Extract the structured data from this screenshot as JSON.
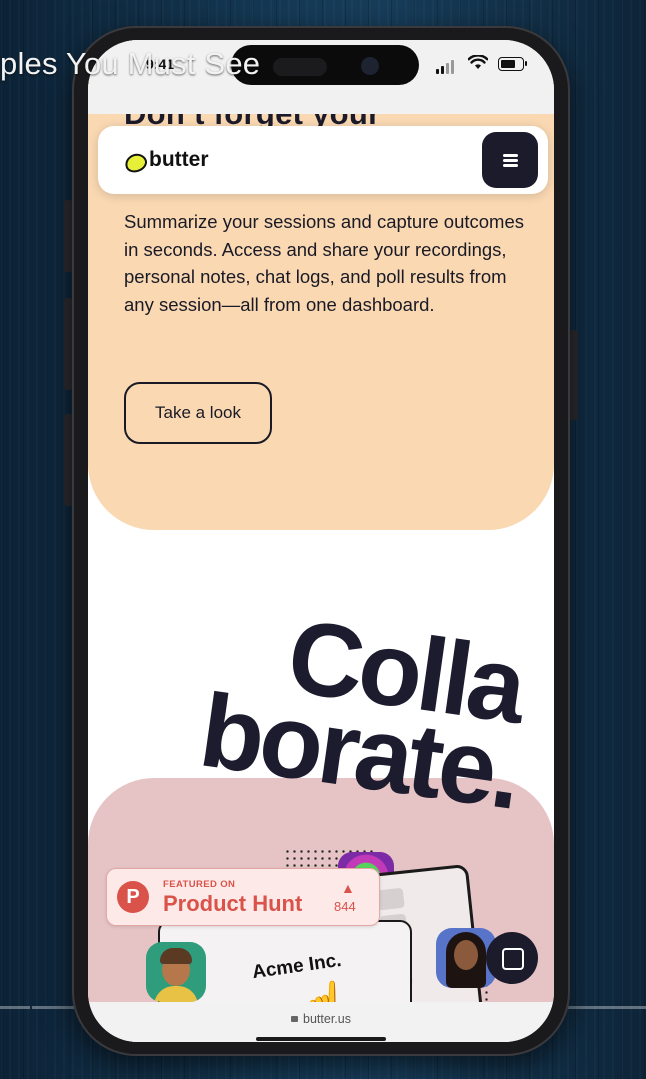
{
  "video": {
    "title": "ples You Must See"
  },
  "status_bar": {
    "time": "9:41"
  },
  "hero": {
    "heading_partial": "Don’t forget your",
    "description": "Summarize your sessions and capture outcomes in seconds. Access and share your recordings, personal notes, chat logs, and poll results from any session—all from one dashboard.",
    "cta_label": "Take a look"
  },
  "nav": {
    "brand": "butter",
    "menu_icon": "hamburger-icon"
  },
  "collaborate": {
    "line1": "Colla",
    "line2": "borate."
  },
  "illustration": {
    "company": "Acme Inc."
  },
  "product_hunt": {
    "featured_on": "FEATURED ON",
    "name": "Product Hunt",
    "upvotes": "844"
  },
  "browser": {
    "url": "butter.us"
  },
  "colors": {
    "peach": "#f9d8b2",
    "pink": "#e6c4c6",
    "navy": "#1c1b2c",
    "logo_yellow": "#e8ef38",
    "product_hunt_red": "#d9534a"
  }
}
